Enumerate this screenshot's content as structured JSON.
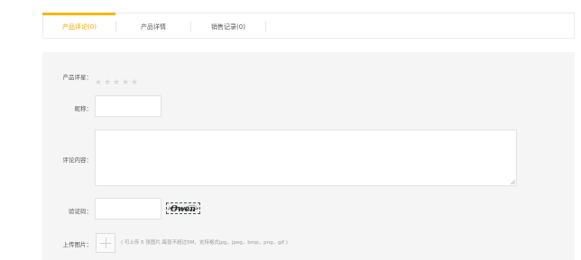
{
  "tabs": [
    {
      "label": "产品评论(0)",
      "active": true
    },
    {
      "label": "产品详情",
      "active": false
    },
    {
      "label": "销售记录(0)",
      "active": false
    }
  ],
  "form": {
    "rating_label": "产品评星：",
    "rating_value": 0,
    "rating_max": 5,
    "nickname_label": "昵称：",
    "nickname_value": "",
    "content_label": "评论内容：",
    "content_value": "",
    "captcha_label": "验证码：",
    "captcha_value": "",
    "captcha_text": "Owen",
    "upload_label": "上传图片：",
    "upload_hint": "( 可上传 5 张图片,每张不超过5M，支持格式jpg，jpeg，bmp，png，gif )"
  },
  "colors": {
    "accent": "#f5b800",
    "active_tab_text": "#f0a400",
    "panel_bg": "#f5f5f5",
    "star_empty": "#d8d8d8"
  },
  "icons": {
    "star": "star-icon",
    "upload": "plus-icon",
    "resize": "resize-grip-icon"
  }
}
